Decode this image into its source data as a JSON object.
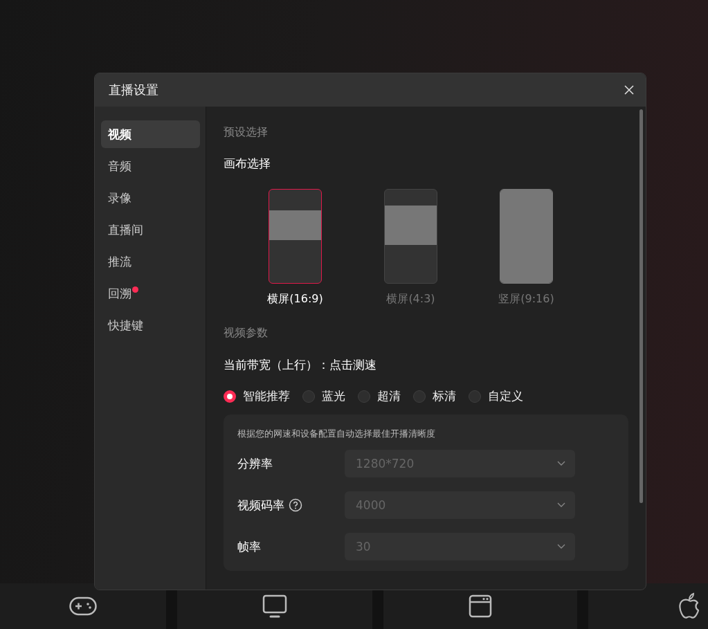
{
  "window": {
    "title": "直播设置"
  },
  "sidebar": {
    "items": [
      {
        "label": "视频",
        "selected": true,
        "dot": false
      },
      {
        "label": "音频",
        "selected": false,
        "dot": false
      },
      {
        "label": "录像",
        "selected": false,
        "dot": false
      },
      {
        "label": "直播间",
        "selected": false,
        "dot": false
      },
      {
        "label": "推流",
        "selected": false,
        "dot": false
      },
      {
        "label": "回溯",
        "selected": false,
        "dot": true
      },
      {
        "label": "快捷键",
        "selected": false,
        "dot": false
      }
    ]
  },
  "preset": {
    "heading": "预设选择"
  },
  "canvas": {
    "heading": "画布选择",
    "options": [
      {
        "label": "横屏(16:9)",
        "kind": "landscape",
        "selected": true
      },
      {
        "label": "横屏(4:3)",
        "kind": "standard",
        "selected": false
      },
      {
        "label": "竖屏(9:16)",
        "kind": "portrait",
        "selected": false
      }
    ]
  },
  "video": {
    "heading": "视频参数",
    "bandwidth": "当前带宽（上行）：点击测速",
    "quality": [
      {
        "label": "智能推荐",
        "selected": true
      },
      {
        "label": "蓝光",
        "selected": false
      },
      {
        "label": "超清",
        "selected": false
      },
      {
        "label": "标清",
        "selected": false
      },
      {
        "label": "自定义",
        "selected": false
      }
    ],
    "panel": {
      "description": "根据您的网速和设备配置自动选择最佳开播清晰度",
      "fields": [
        {
          "label": "分辨率",
          "help": false,
          "value": "1280*720",
          "disabled": true
        },
        {
          "label": "视频码率",
          "help": true,
          "value": "4000",
          "disabled": true
        },
        {
          "label": "帧率",
          "help": false,
          "value": "30",
          "disabled": true
        }
      ]
    }
  },
  "taskbar": {
    "items": [
      {
        "kind": "gamepad"
      },
      {
        "kind": "monitor"
      },
      {
        "kind": "window"
      },
      {
        "kind": "apple"
      }
    ]
  }
}
